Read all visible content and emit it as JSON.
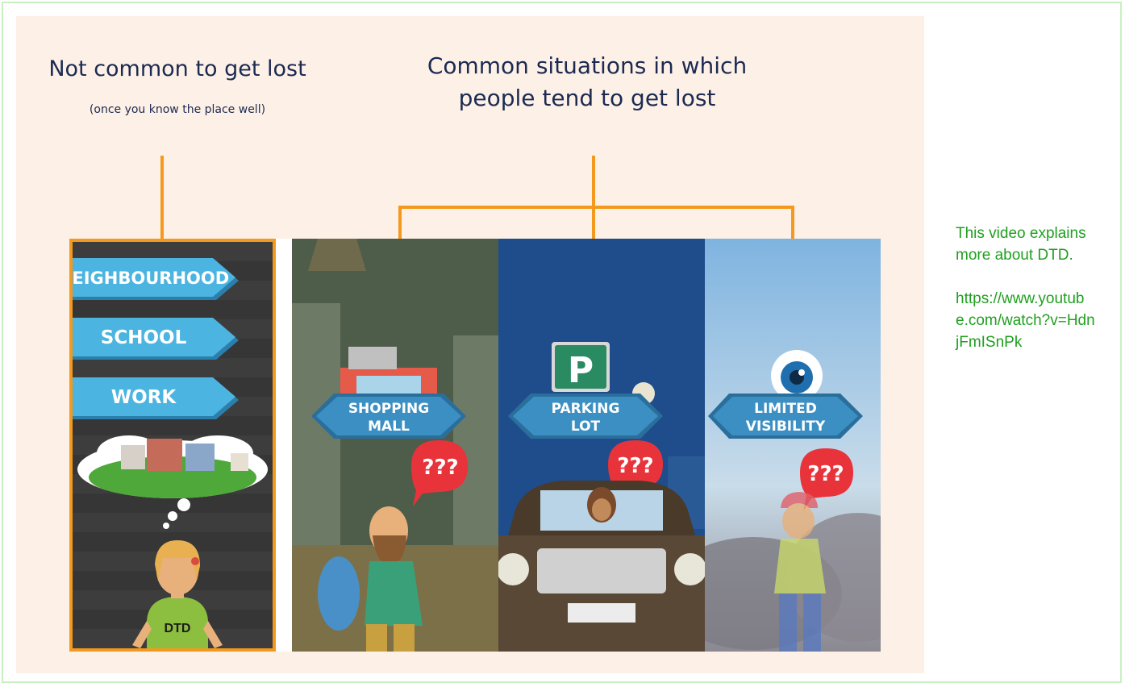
{
  "left_heading": {
    "title": "Not common to get lost",
    "subtitle": "(once you know the place well)"
  },
  "right_heading": {
    "line1": "Common situations in which",
    "line2": "people tend to get lost"
  },
  "familiar_panel": {
    "signs": [
      "NEIGHBOURHOOD",
      "SCHOOL",
      "WORK"
    ],
    "shirt_label": "DTD"
  },
  "situations": [
    {
      "line1": "SHOPPING",
      "line2": "MALL",
      "bubble": "???"
    },
    {
      "line1": "PARKING",
      "line2": "LOT",
      "bubble": "???",
      "sign": "P"
    },
    {
      "line1": "LIMITED",
      "line2": "VISIBILITY",
      "bubble": "???"
    }
  ],
  "side_note": {
    "text": "This video explains more about DTD.",
    "url": "https://www.youtube.com/watch?v=HdnjFmISnPk"
  },
  "colors": {
    "accent": "#f39a1e",
    "heading": "#1c2a52",
    "background": "#fdf0e6",
    "sign_blue": "#3ea6d8",
    "note_green": "#1fa01f",
    "bubble_red": "#e8333a"
  }
}
